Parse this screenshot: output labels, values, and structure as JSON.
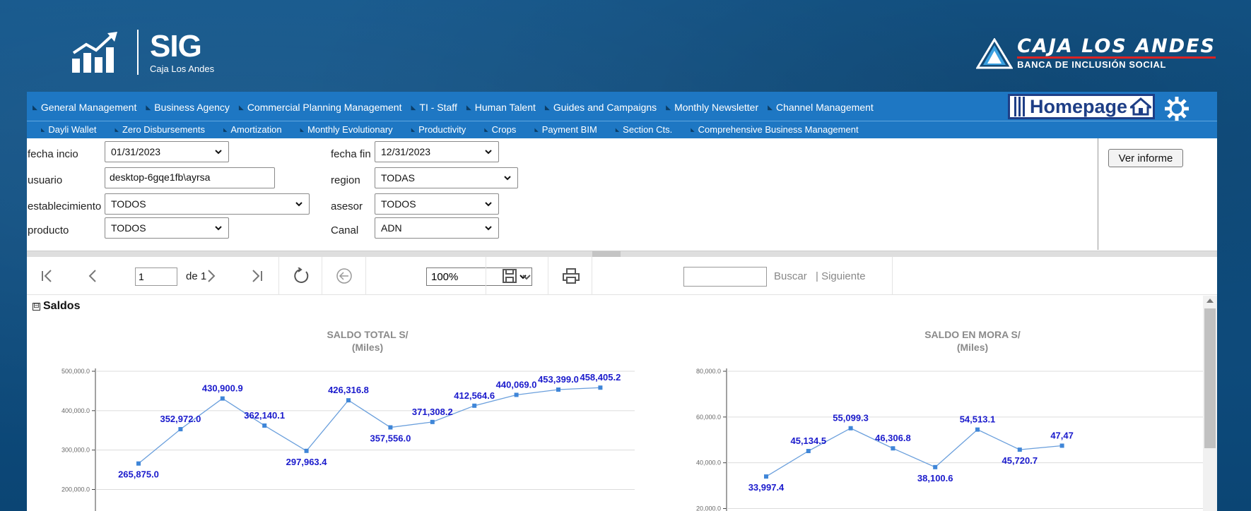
{
  "branding": {
    "sig_title": "SIG",
    "sig_subtitle": "Caja Los Andes",
    "bank_name": "CAJA LOS ANDES",
    "bank_tagline": "BANCA DE INCLUSIÓN SOCIAL",
    "accent_red": "#d22222",
    "menu_blue": "#1e77c3",
    "navy": "#1e3e86"
  },
  "menu_primary": [
    "General Management",
    "Business Agency",
    "Commercial Planning Management",
    "TI - Staff",
    "Human Talent",
    "Guides and Campaigns",
    "Monthly Newsletter",
    "Channel Management"
  ],
  "homepage_label": "Homepage",
  "menu_secondary": [
    "Dayli Wallet",
    "Zero Disbursements",
    "Amortization",
    "Monthly Evolutionary",
    "Productivity",
    "Crops",
    "Payment BIM",
    "Section Cts.",
    "Comprehensive Business Management"
  ],
  "params": {
    "fecha_inicio_label": "fecha incio",
    "fecha_inicio_value": "01/31/2023",
    "fecha_fin_label": "fecha fin",
    "fecha_fin_value": "12/31/2023",
    "usuario_label": "usuario",
    "usuario_value": "desktop-6gqe1fb\\ayrsa",
    "region_label": "region",
    "region_value": "TODAS",
    "establecimiento_label": "establecimiento",
    "establecimiento_value": "TODOS",
    "asesor_label": "asesor",
    "asesor_value": "TODOS",
    "producto_label": "producto",
    "producto_value": "TODOS",
    "canal_label": "Canal",
    "canal_value": "ADN",
    "ver_informe": "Ver informe"
  },
  "toolbar": {
    "page_value": "1",
    "of_label": "de 1",
    "zoom_value": "100%",
    "find_label": "Buscar",
    "next_label": "| Siguiente"
  },
  "report": {
    "section_title": "Saldos",
    "section_toggle": "⊟"
  },
  "chart_data": [
    {
      "type": "line",
      "title": "SALDO TOTAL S/",
      "subtitle": "(Miles)",
      "ytick_labels": [
        "500,000.0",
        "400,000.0",
        "300,000.0",
        "200,000.0"
      ],
      "ylim": [
        140000,
        500000
      ],
      "grid": true,
      "series_color": "#6a9fdc",
      "label_color": "#1a1acc",
      "values": [
        265875.0,
        352972.0,
        430900.9,
        362140.1,
        297963.4,
        426316.8,
        357556.0,
        371308.2,
        412564.6,
        440069.0,
        453399.0,
        458405.2
      ],
      "labels": [
        "265,875.0",
        "352,972.0",
        "430,900.9",
        "362,140.1",
        "297,963.4",
        "426,316.8",
        "357,556.0",
        "371,308.2",
        "412,564.6",
        "440,069.0",
        "453,399.0",
        "458,405.2"
      ]
    },
    {
      "type": "line",
      "title": "SALDO EN MORA S/",
      "subtitle": "(Miles)",
      "ytick_labels": [
        "80,000.0",
        "60,000.0",
        "40,000.0",
        "20,000.0"
      ],
      "ylim": [
        18000,
        80000
      ],
      "grid": true,
      "series_color": "#6a9fdc",
      "label_color": "#1a1acc",
      "values": [
        33997.4,
        45134.5,
        55099.3,
        46306.8,
        38100.6,
        54513.1,
        45720.7,
        47470.0
      ],
      "labels": [
        "33,997.4",
        "45,134.5",
        "55,099.3",
        "46,306.8",
        "38,100.6",
        "54,513.1",
        "45,720.7",
        "47,47"
      ]
    }
  ]
}
